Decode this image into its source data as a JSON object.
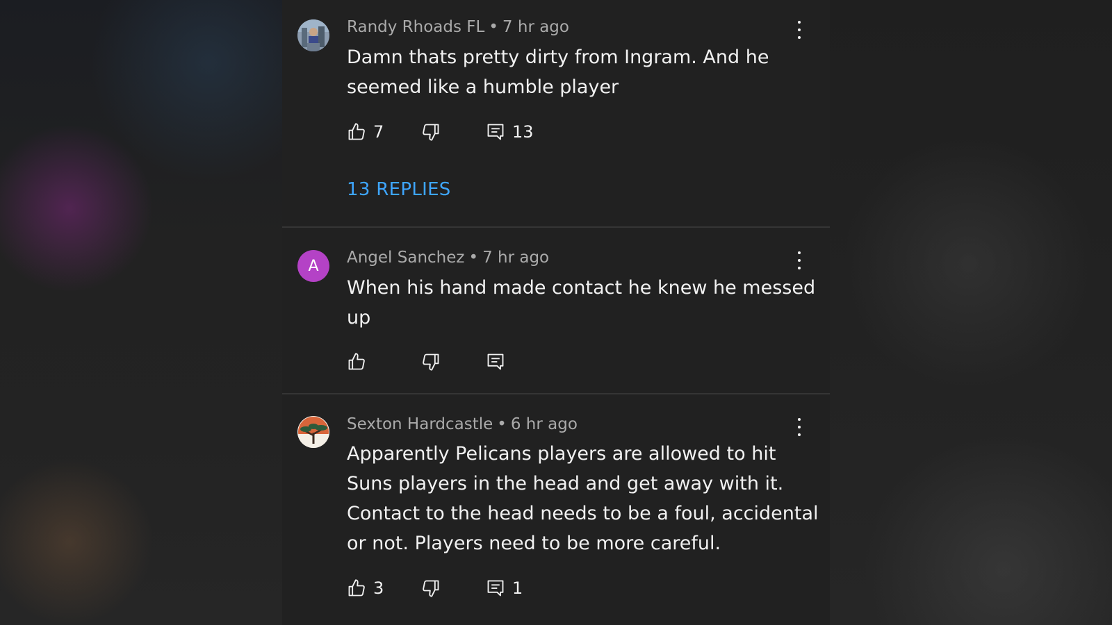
{
  "colors": {
    "panel_bg": "#212121",
    "text": "#f1f1f1",
    "meta": "#aaaaaa",
    "link": "#3ea6ff",
    "avatar_a": "#b442c6"
  },
  "comments": [
    {
      "author": "Randy Rhoads FL",
      "time": "7 hr ago",
      "text": "Damn thats pretty dirty from Ingram. And he seemed like a humble player",
      "likes": "7",
      "replies_count": "13",
      "replies_link": "13 REPLIES",
      "avatar": "photo-avatar"
    },
    {
      "author": "Angel Sanchez",
      "time": "7 hr ago",
      "text": "When his hand made contact he knew he messed up",
      "likes": "",
      "replies_count": "",
      "avatar_letter": "A"
    },
    {
      "author": "Sexton Hardcastle",
      "time": "6 hr ago",
      "text": "Apparently Pelicans players are allowed to hit Suns players in the head and get away with it. Contact to the head needs to be a foul, accidental or not. Players need to be more careful.",
      "likes": "3",
      "replies_count": "1",
      "avatar": "tree-avatar"
    }
  ],
  "icons": [
    "thumb-up-icon",
    "thumb-down-icon",
    "reply-icon",
    "more-vert-icon"
  ]
}
